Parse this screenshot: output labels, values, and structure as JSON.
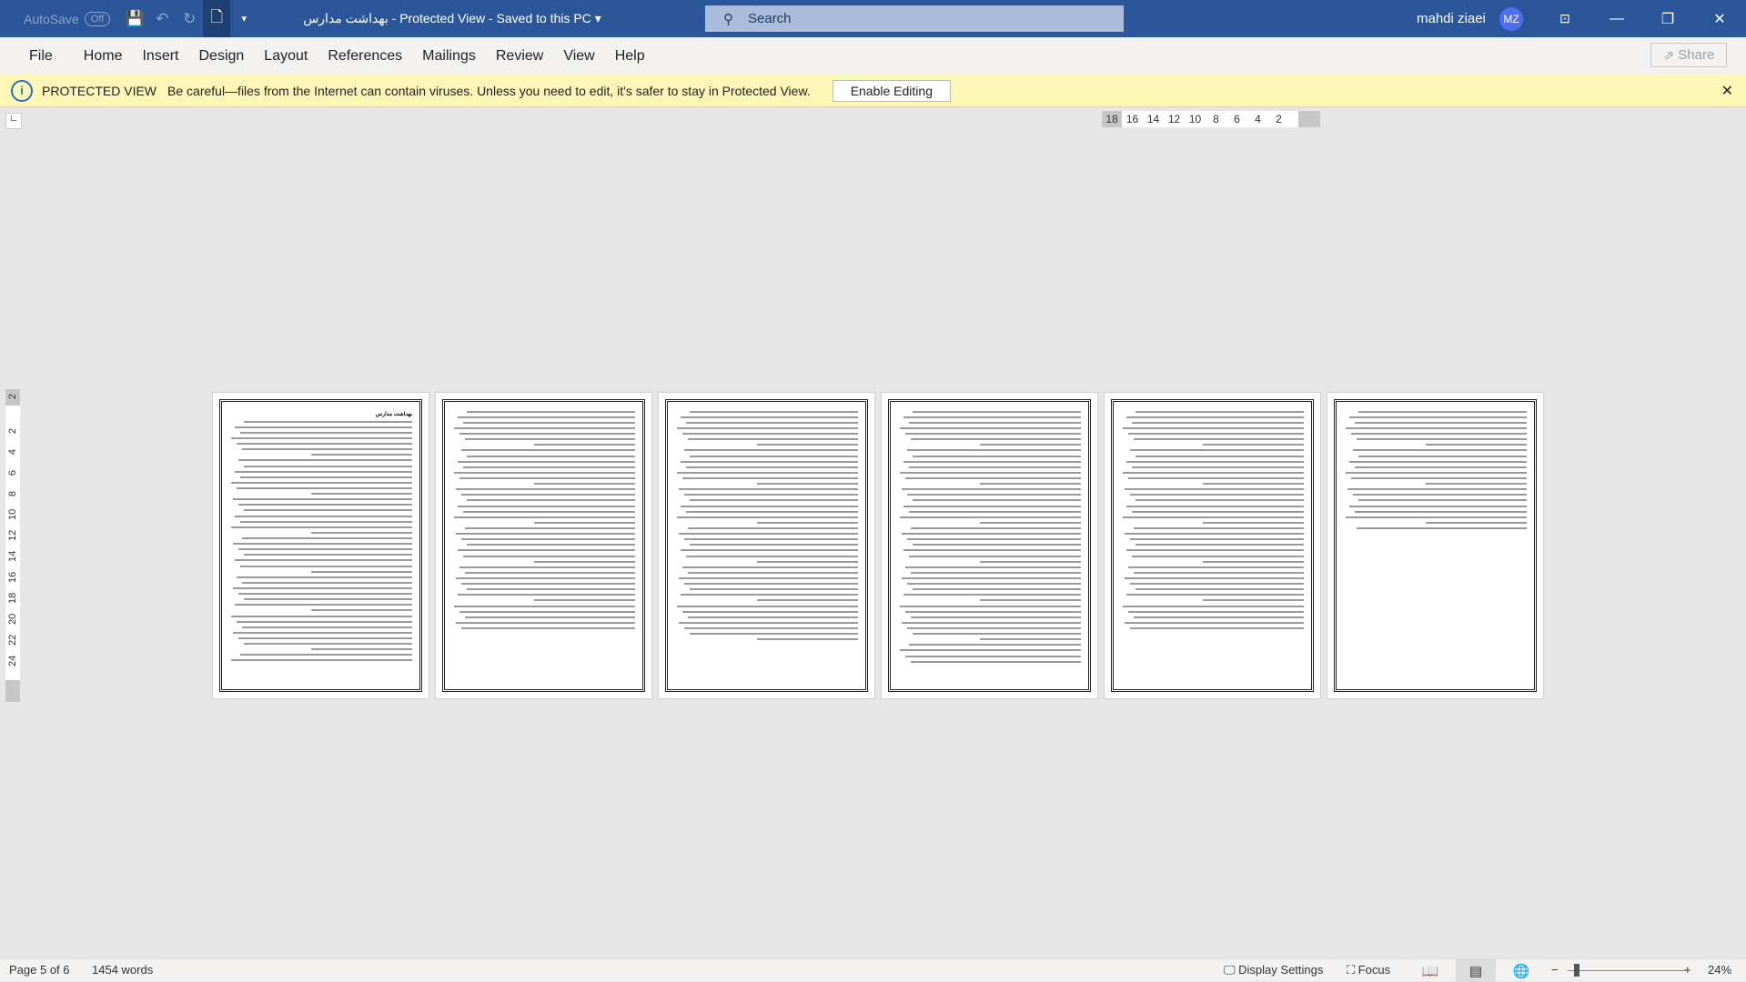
{
  "titlebar": {
    "autosave": "AutoSave",
    "autosave_state": "Off",
    "document_title": "بهداشت مدارس  -  Protected View  -  Saved to this PC",
    "search_placeholder": "Search",
    "user_name": "mahdi ziaei",
    "user_initials": "MZ"
  },
  "menu": {
    "items": [
      "File",
      "Home",
      "Insert",
      "Design",
      "Layout",
      "References",
      "Mailings",
      "Review",
      "View",
      "Help"
    ],
    "share": "Share"
  },
  "protected_view": {
    "label": "PROTECTED VIEW",
    "message": "Be careful—files from the Internet can contain viruses. Unless you need to edit, it's safer to stay in Protected View.",
    "enable_button": "Enable Editing"
  },
  "ruler": {
    "horizontal": [
      "18",
      "16",
      "14",
      "12",
      "10",
      "8",
      "6",
      "4",
      "2"
    ],
    "vertical": [
      "2",
      "2",
      "4",
      "6",
      "8",
      "10",
      "12",
      "14",
      "16",
      "18",
      "20",
      "22",
      "24"
    ]
  },
  "document": {
    "page1_heading": "بهداشت مدارس",
    "page_count": 6
  },
  "status": {
    "page": "Page 5 of 6",
    "words": "1454 words",
    "display_settings": "Display Settings",
    "focus": "Focus",
    "zoom": "24%",
    "zoom_percent": 24
  },
  "colors": {
    "titlebar": "#2b579a",
    "protected_bar": "#fcf7b6",
    "avatar": "#4e6ef2"
  }
}
